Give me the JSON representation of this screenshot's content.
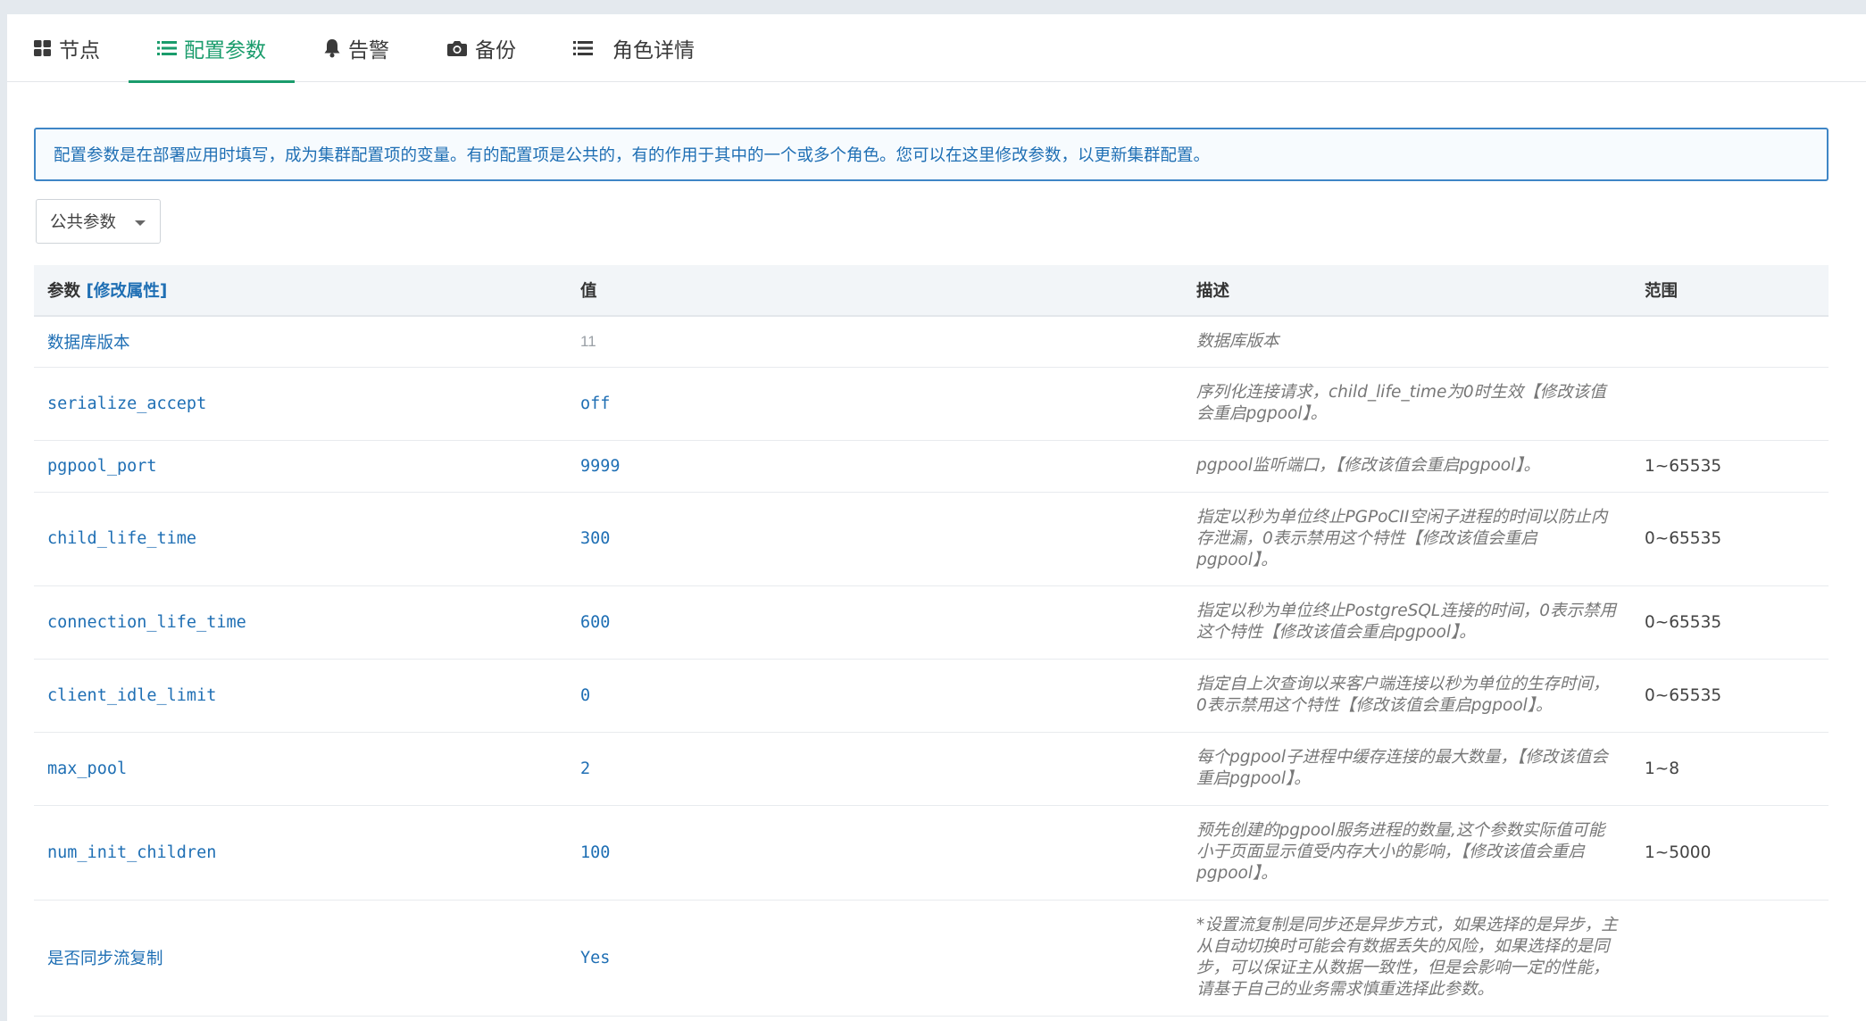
{
  "tabs": [
    {
      "label": "节点",
      "icon": "grid-icon"
    },
    {
      "label": "配置参数",
      "icon": "list-icon"
    },
    {
      "label": "告警",
      "icon": "bell-icon"
    },
    {
      "label": "备份",
      "icon": "camera-icon"
    },
    {
      "label": "角色详情",
      "icon": "list-icon"
    }
  ],
  "active_tab": "配置参数",
  "colors": {
    "accent": "#1a9c6c",
    "link": "#1f6fb4",
    "info_border": "#3f86c6"
  },
  "info_text": "配置参数是在部署应用时填写，成为集群配置项的变量。有的配置项是公共的，有的作用于其中的一个或多个角色。您可以在这里修改参数，以更新集群配置。",
  "scope_select": {
    "value": "公共参数"
  },
  "table": {
    "headers": {
      "param": "参数",
      "modify": "[修改属性]",
      "value": "值",
      "desc": "描述",
      "range": "范围"
    },
    "rows": [
      {
        "name": "数据库版本",
        "value": "11",
        "desc": "数据库版本",
        "range": ""
      },
      {
        "name": "serialize_accept",
        "value": "off",
        "desc": "序列化连接请求，child_life_time为0时生效【修改该值会重启pgpool】。",
        "range": ""
      },
      {
        "name": "pgpool_port",
        "value": "9999",
        "desc": "pgpool监听端口，【修改该值会重启pgpool】。",
        "range": "1~65535"
      },
      {
        "name": "child_life_time",
        "value": "300",
        "desc": "指定以秒为单位终止PGPoCII空闲子进程的时间以防止内存泄漏，0表示禁用这个特性【修改该值会重启pgpool】。",
        "range": "0~65535"
      },
      {
        "name": "connection_life_time",
        "value": "600",
        "desc": "指定以秒为单位终止PostgreSQL连接的时间，0表示禁用这个特性【修改该值会重启pgpool】。",
        "range": "0~65535"
      },
      {
        "name": "client_idle_limit",
        "value": "0",
        "desc": "指定自上次查询以来客户端连接以秒为单位的生存时间，0表示禁用这个特性【修改该值会重启pgpool】。",
        "range": "0~65535"
      },
      {
        "name": "max_pool",
        "value": "2",
        "desc": "每个pgpool子进程中缓存连接的最大数量，【修改该值会重启pgpool】。",
        "range": "1~8"
      },
      {
        "name": "num_init_children",
        "value": "100",
        "desc": "预先创建的pgpool服务进程的数量,这个参数实际值可能小于页面显示值受内存大小的影响，【修改该值会重启pgpool】。",
        "range": "1~5000"
      },
      {
        "name": "是否同步流复制",
        "value": "Yes",
        "desc": "*设置流复制是同步还是异步方式，如果选择的是异步，主从自动切换时可能会有数据丢失的风险，如果选择的是同步，可以保证主从数据一致性，但是会影响一定的性能，请基于自己的业务需求慎重选择此参数。",
        "range": ""
      }
    ]
  }
}
